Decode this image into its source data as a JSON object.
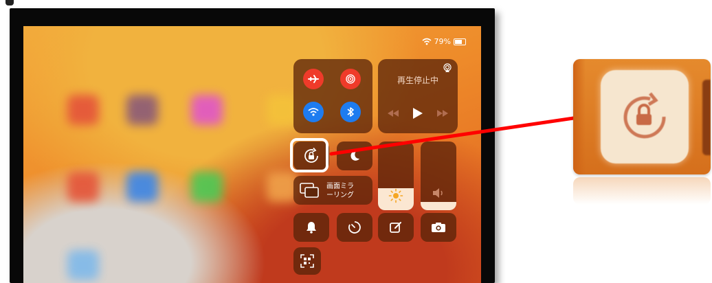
{
  "status_bar": {
    "battery_percent": "79%"
  },
  "media": {
    "title": "再生停止中"
  },
  "screen_mirroring": {
    "label_line1": "画面ミラ",
    "label_line2": "ーリング"
  },
  "sliders": {
    "brightness_level": 0.32,
    "volume_level": 0.12
  },
  "colors": {
    "airplane": "#ef3b2a",
    "airdrop": "#ef3b2a",
    "wifi": "#1e7cf0",
    "bluetooth": "#1e7cf0",
    "highlight_box": "#ffffff",
    "arrow": "#ff0000"
  },
  "icons": [
    "airplane-icon",
    "airdrop-icon",
    "wifi-icon",
    "bluetooth-icon",
    "airplay-icon",
    "play-icon",
    "rewind-icon",
    "fast-forward-icon",
    "orientation-lock-icon",
    "moon-icon",
    "screen-mirroring-icon",
    "sun-icon",
    "speaker-icon",
    "bell-icon",
    "timer-icon",
    "note-icon",
    "camera-icon",
    "qr-code-icon"
  ]
}
